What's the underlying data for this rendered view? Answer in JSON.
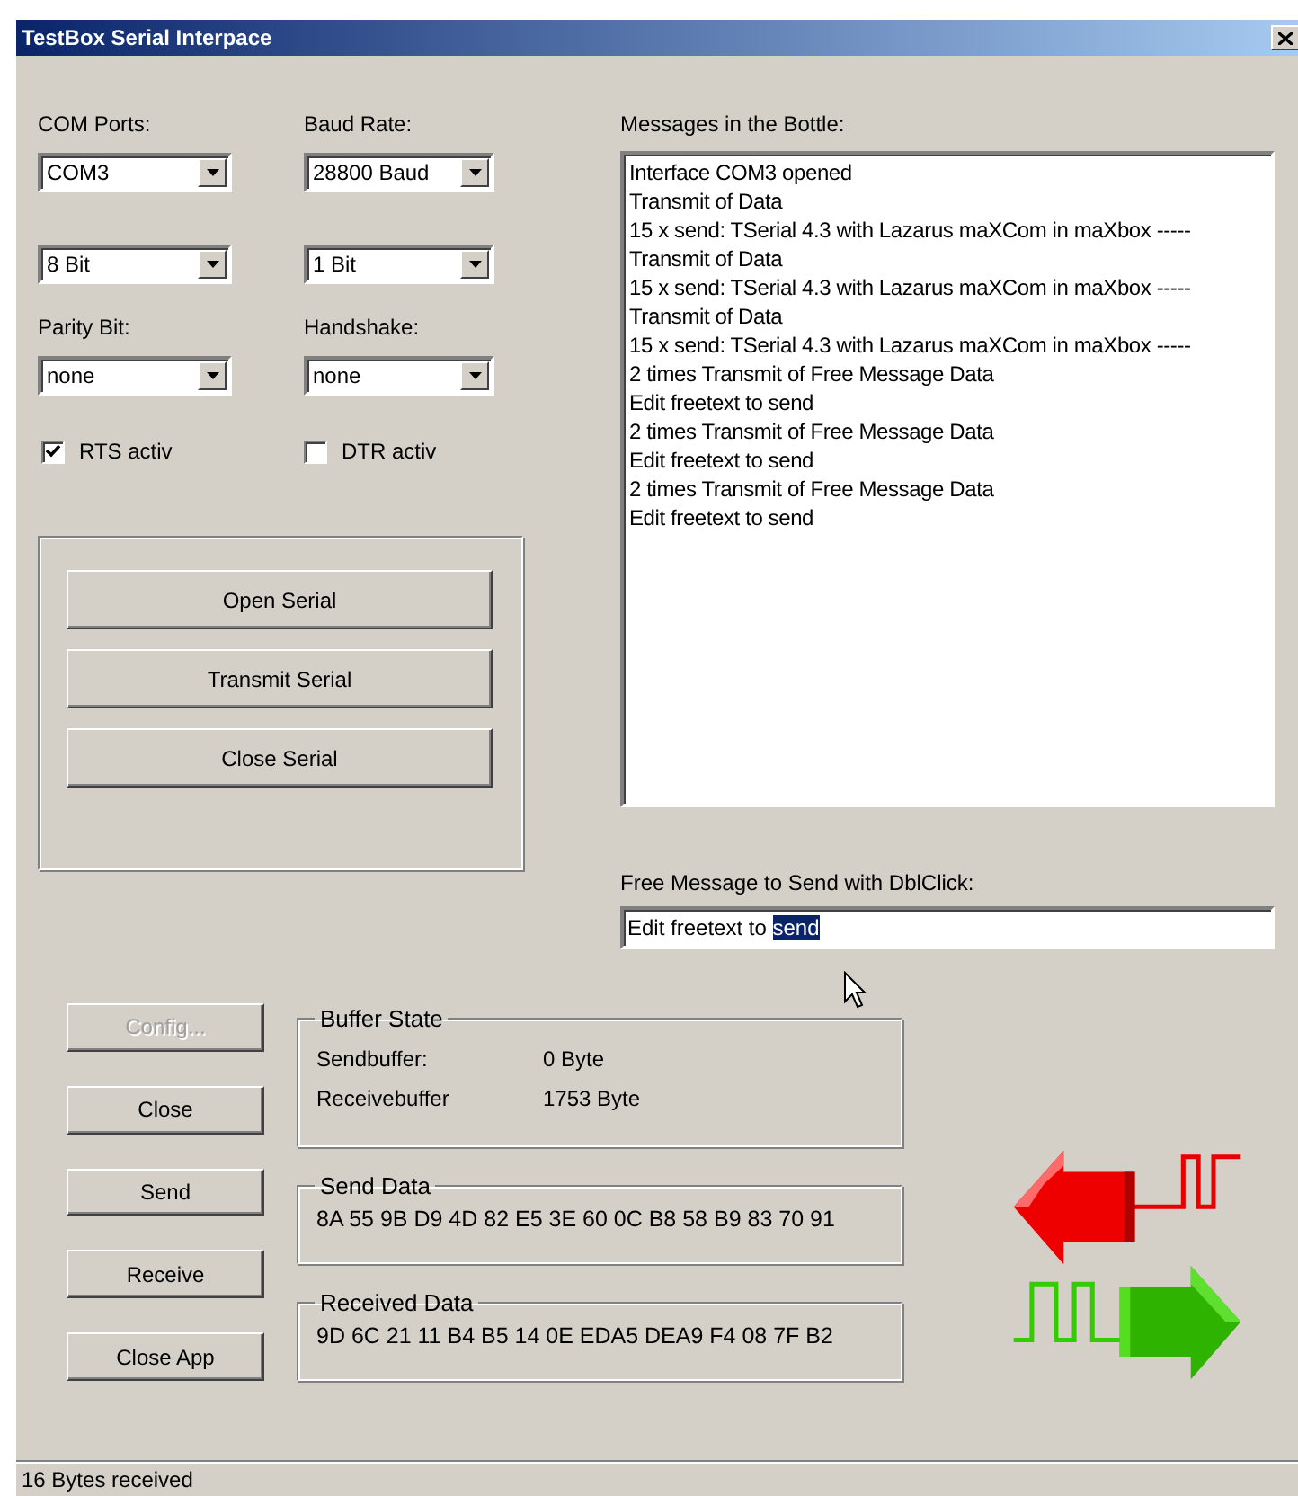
{
  "window": {
    "title": "TestBox Serial Interpace"
  },
  "settings": [
    {
      "label": "COM Ports:",
      "value": "COM3"
    },
    {
      "label": "Baud Rate:",
      "value": "28800 Baud"
    },
    {
      "value": "8 Bit"
    },
    {
      "value": "1 Bit"
    },
    {
      "label": "Parity Bit:",
      "value": "none"
    },
    {
      "label": "Handshake:",
      "value": "none"
    }
  ],
  "options": [
    {
      "label": "RTS activ",
      "checked": true
    },
    {
      "label": "DTR activ",
      "checked": false
    }
  ],
  "serial_buttons": [
    "Open Serial",
    "Transmit Serial",
    "Close Serial"
  ],
  "messages": {
    "label": "Messages in the Bottle:",
    "lines": [
      "Interface COM3 opened",
      "Transmit of Data",
      "15 x send: TSerial 4.3 with Lazarus maXCom in maXbox -----",
      "Transmit of Data",
      "15 x send: TSerial 4.3 with Lazarus maXCom in maXbox -----",
      "Transmit of Data",
      "15 x send: TSerial 4.3 with Lazarus maXCom in maXbox -----",
      "2 times Transmit of Free Message Data",
      "Edit freetext to send",
      "2 times Transmit of Free Message Data",
      "Edit freetext to send",
      "2 times Transmit of Free Message Data",
      "Edit freetext to send"
    ]
  },
  "free_message": {
    "label": "Free Message to Send with DblClick:",
    "value": "Edit freetext to ",
    "selection": "send"
  },
  "buttons": [
    {
      "label": "Config...",
      "disabled": true
    },
    {
      "label": "Close",
      "disabled": false
    },
    {
      "label": "Send",
      "disabled": false
    },
    {
      "label": "Receive",
      "disabled": false
    },
    {
      "label": "Close App",
      "disabled": false
    }
  ],
  "buffer_state": {
    "title": "Buffer State",
    "rows": [
      {
        "name": "Sendbuffer:",
        "value": "0 Byte"
      },
      {
        "name": "Receivebuffer",
        "value": "1753 Byte"
      }
    ]
  },
  "send_data": {
    "title": "Send Data",
    "value": "8A 55 9B D9 4D 82 E5 3E 60 0C B8 58 B9 83 70 91"
  },
  "received_data": {
    "title": "Received Data",
    "value": "9D 6C 21 11 B4 B5 14 0E EDA5 DEA9 F4 08 7F B2"
  },
  "status_bar": "16 Bytes received"
}
